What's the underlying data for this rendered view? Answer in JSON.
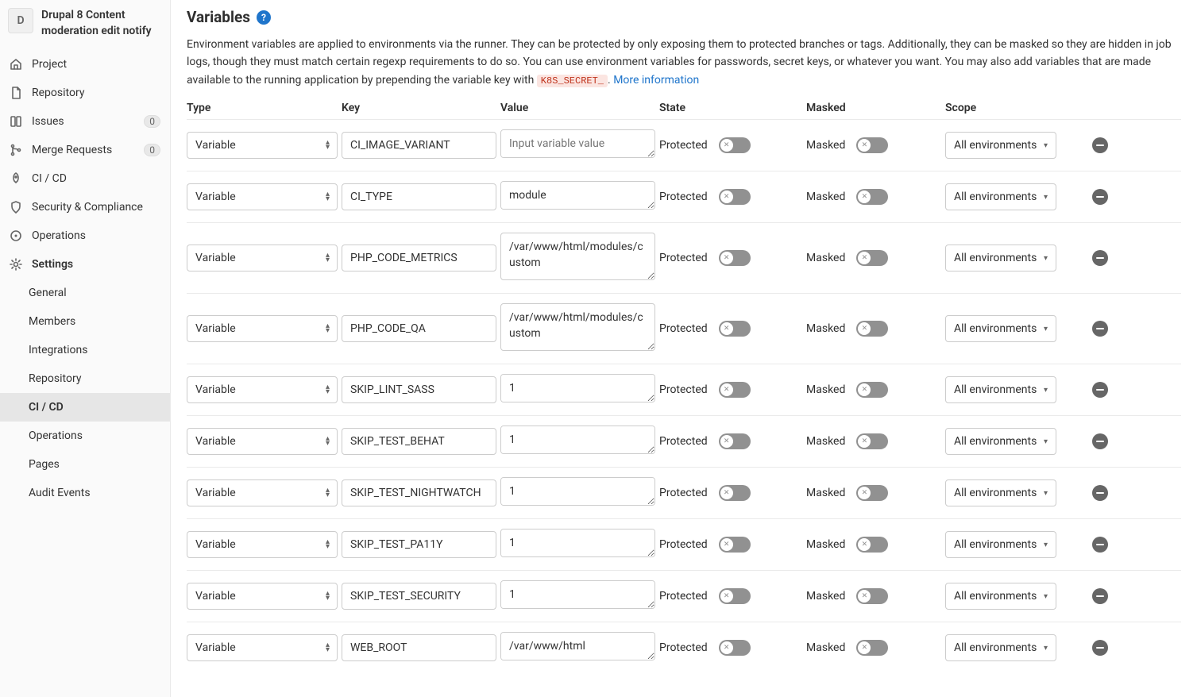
{
  "project": {
    "avatar_letter": "D",
    "title": "Drupal 8 Content moderation edit notify"
  },
  "nav": [
    {
      "icon": "home",
      "label": "Project"
    },
    {
      "icon": "file",
      "label": "Repository"
    },
    {
      "icon": "issues",
      "label": "Issues",
      "badge": "0"
    },
    {
      "icon": "merge",
      "label": "Merge Requests",
      "badge": "0"
    },
    {
      "icon": "rocket",
      "label": "CI / CD"
    },
    {
      "icon": "shield",
      "label": "Security & Compliance"
    },
    {
      "icon": "cloud",
      "label": "Operations"
    },
    {
      "icon": "gear",
      "label": "Settings",
      "bold": true,
      "children": [
        {
          "label": "General"
        },
        {
          "label": "Members"
        },
        {
          "label": "Integrations"
        },
        {
          "label": "Repository"
        },
        {
          "label": "CI / CD",
          "active": true
        },
        {
          "label": "Operations"
        },
        {
          "label": "Pages"
        },
        {
          "label": "Audit Events"
        }
      ]
    }
  ],
  "section": {
    "title": "Variables",
    "description_prelink": "Environment variables are applied to environments via the runner. They can be protected by only exposing them to protected branches or tags. Additionally, they can be masked so they are hidden in job logs, though they must match certain regexp requirements to do so. You can use environment variables for passwords, secret keys, or whatever you want. You may also add variables that are made available to the running application by prepending the variable key with ",
    "code": "K8S_SECRET_",
    "dot": ". ",
    "more_info": "More information"
  },
  "headers": {
    "type": "Type",
    "key": "Key",
    "value": "Value",
    "state": "State",
    "masked": "Masked",
    "scope": "Scope"
  },
  "labels": {
    "protected": "Protected",
    "masked": "Masked"
  },
  "defaults": {
    "type_option": "Variable",
    "scope_option": "All environments",
    "value_placeholder": "Input variable value"
  },
  "variables": [
    {
      "key": "CI_IMAGE_VARIANT",
      "value": "",
      "tall": false
    },
    {
      "key": "CI_TYPE",
      "value": "module",
      "tall": false
    },
    {
      "key": "PHP_CODE_METRICS",
      "value": "/var/www/html/modules/custom",
      "tall": true
    },
    {
      "key": "PHP_CODE_QA",
      "value": "/var/www/html/modules/custom",
      "tall": true
    },
    {
      "key": "SKIP_LINT_SASS",
      "value": "1",
      "tall": false
    },
    {
      "key": "SKIP_TEST_BEHAT",
      "value": "1",
      "tall": false
    },
    {
      "key": "SKIP_TEST_NIGHTWATCH",
      "value": "1",
      "tall": false
    },
    {
      "key": "SKIP_TEST_PA11Y",
      "value": "1",
      "tall": false
    },
    {
      "key": "SKIP_TEST_SECURITY",
      "value": "1",
      "tall": false
    },
    {
      "key": "WEB_ROOT",
      "value": "/var/www/html",
      "tall": false
    }
  ]
}
